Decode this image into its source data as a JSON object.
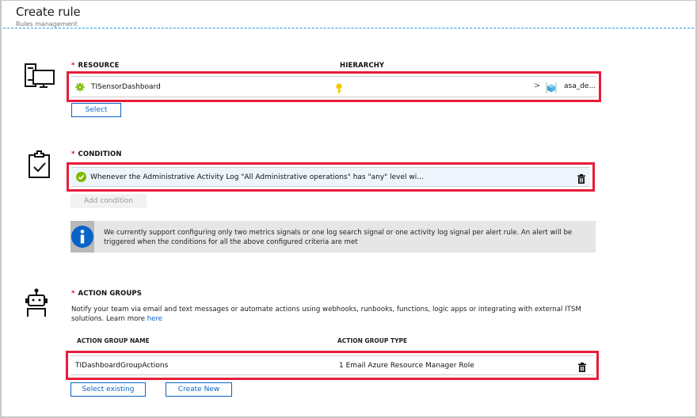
{
  "header": {
    "title": "Create rule",
    "subtitle": "Rules management"
  },
  "resource": {
    "required_marker": "*",
    "label": "RESOURCE",
    "hierarchy_label": "HIERARCHY",
    "name": "TISensorDashboard",
    "hierarchy_chevron": ">",
    "hierarchy_item": "asa_de...",
    "select_button": "Select",
    "icons": {
      "section": "computer-monitor-icon",
      "resource": "gear-cog-icon",
      "hierarchy": "key-icon",
      "hierarchy_item": "cube-icon"
    }
  },
  "condition": {
    "required_marker": "*",
    "label": "CONDITION",
    "text": "Whenever the Administrative Activity Log \"All Administrative operations\" has \"any\" level wi...",
    "add_button": "Add condition",
    "info": "We currently support configuring only two metrics signals or one log search signal or one activity log signal per alert rule. An alert will be triggered when the conditions for all the above configured criteria are met",
    "icons": {
      "section": "clipboard-check-icon",
      "status": "check-circle-icon",
      "delete": "trash-icon",
      "info": "info-icon"
    }
  },
  "action_groups": {
    "required_marker": "*",
    "label": "ACTION GROUPS",
    "description": "Notify your team via email and text messages or automate actions using webhooks, runbooks, functions, logic apps or integrating with external ITSM solutions. Learn more ",
    "link_text": "here",
    "columns": [
      "ACTION GROUP NAME",
      "ACTION GROUP TYPE"
    ],
    "rows": [
      {
        "name": "TIDashboardGroupActions",
        "type": "1 Email Azure Resource Manager Role"
      }
    ],
    "select_existing_button": "Select existing",
    "create_new_button": "Create New",
    "icons": {
      "section": "robot-icon",
      "delete": "trash-icon"
    }
  },
  "colors": {
    "highlight_border": "#e81c3a",
    "accent": "#0a63c9",
    "required": "#e81123",
    "divider": "#1ba1e2",
    "success": "#7fba00",
    "info": "#0a63c9"
  }
}
